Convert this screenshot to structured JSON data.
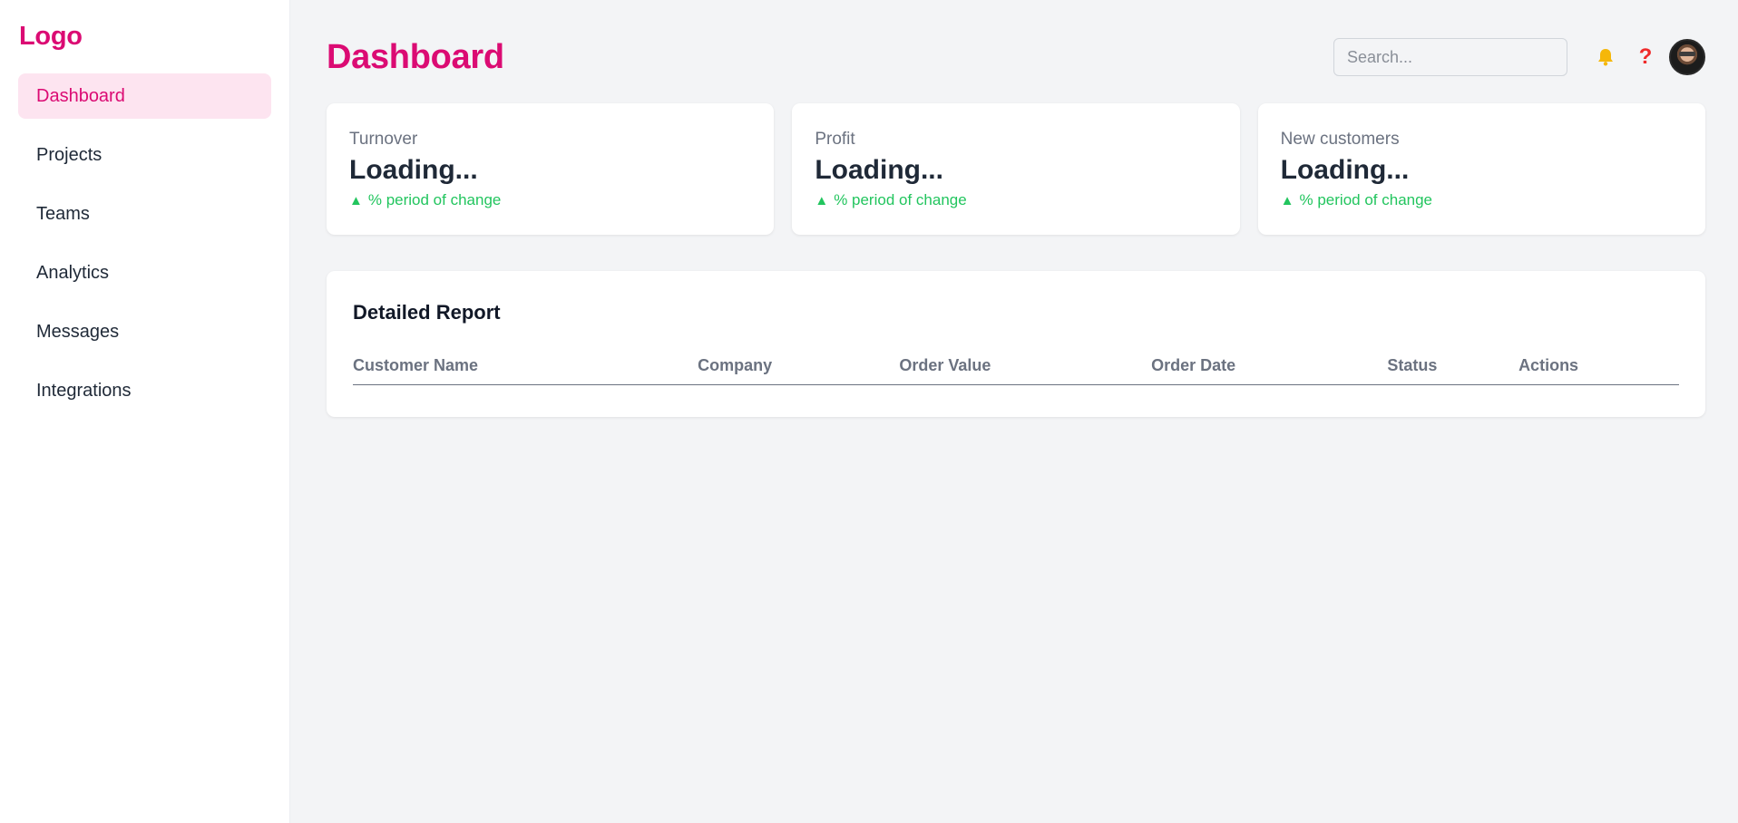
{
  "sidebar": {
    "logo": "Logo",
    "items": [
      {
        "label": "Dashboard"
      },
      {
        "label": "Projects"
      },
      {
        "label": "Teams"
      },
      {
        "label": "Analytics"
      },
      {
        "label": "Messages"
      },
      {
        "label": "Integrations"
      }
    ],
    "active_index": 0
  },
  "header": {
    "title": "Dashboard",
    "search_placeholder": "Search...",
    "search_value": "",
    "icons": [
      "bell-icon",
      "help-icon",
      "avatar"
    ]
  },
  "cards": [
    {
      "label": "Turnover",
      "value": "Loading...",
      "change_text": "% period of change",
      "trend_icon": "up-triangle-icon"
    },
    {
      "label": "Profit",
      "value": "Loading...",
      "change_text": "% period of change",
      "trend_icon": "up-triangle-icon"
    },
    {
      "label": "New customers",
      "value": "Loading...",
      "change_text": "% period of change",
      "trend_icon": "up-triangle-icon"
    }
  ],
  "report": {
    "title": "Detailed Report",
    "columns": [
      "Customer Name",
      "Company",
      "Order Value",
      "Order Date",
      "Status",
      "Actions"
    ],
    "rows": []
  },
  "colors": {
    "brand": "#db0b73",
    "active_bg": "#fde4f0",
    "positive": "#22c55e",
    "bell": "#f5b70a",
    "help": "#ef2b2b"
  }
}
